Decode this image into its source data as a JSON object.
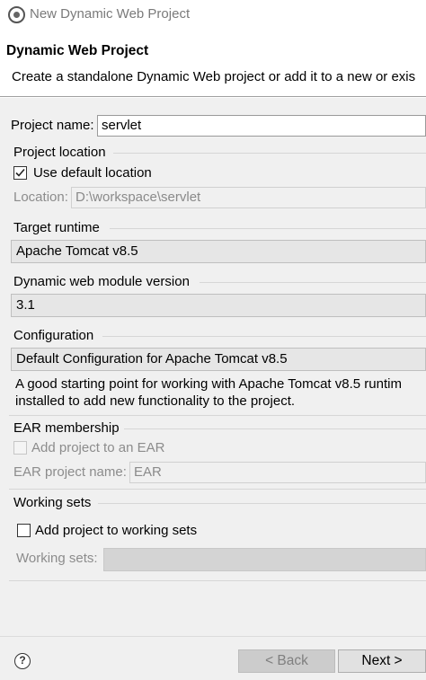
{
  "window": {
    "title": "New Dynamic Web Project"
  },
  "header": {
    "title": "Dynamic Web Project",
    "description": "Create a standalone Dynamic Web project or add it to a new or exis"
  },
  "project": {
    "name_label": "Project name:",
    "name_value": "servlet"
  },
  "location": {
    "group_label": "Project location",
    "use_default_label": "Use default location",
    "use_default_checked": true,
    "location_label": "Location:",
    "location_value": "D:\\workspace\\servlet"
  },
  "runtime": {
    "group_label": "Target runtime",
    "selected": "Apache Tomcat v8.5"
  },
  "module": {
    "group_label": "Dynamic web module version",
    "selected": "3.1"
  },
  "configuration": {
    "group_label": "Configuration",
    "selected": "Default Configuration for Apache Tomcat v8.5",
    "description_line1": "A good starting point for working with Apache Tomcat v8.5 runtim",
    "description_line2": "installed to add new functionality to the project."
  },
  "ear": {
    "group_label": "EAR membership",
    "add_label": "Add project to an EAR",
    "add_checked": false,
    "name_label": "EAR project name:",
    "name_value": "EAR"
  },
  "working_sets": {
    "group_label": "Working sets",
    "add_label": "Add project to working sets",
    "add_checked": false,
    "sets_label": "Working sets:",
    "sets_value": ""
  },
  "footer": {
    "help_symbol": "?",
    "back_label": "< Back",
    "next_label": "Next >"
  },
  "icons": {
    "app": "eclipse-icon",
    "help": "help-icon",
    "checkmark": "checkmark-icon"
  },
  "colors": {
    "dialog_bg": "#f0f0f0",
    "header_bg": "#ffffff",
    "combo_bg": "#e6e6e6",
    "disabled_text": "#8c8c8c"
  }
}
